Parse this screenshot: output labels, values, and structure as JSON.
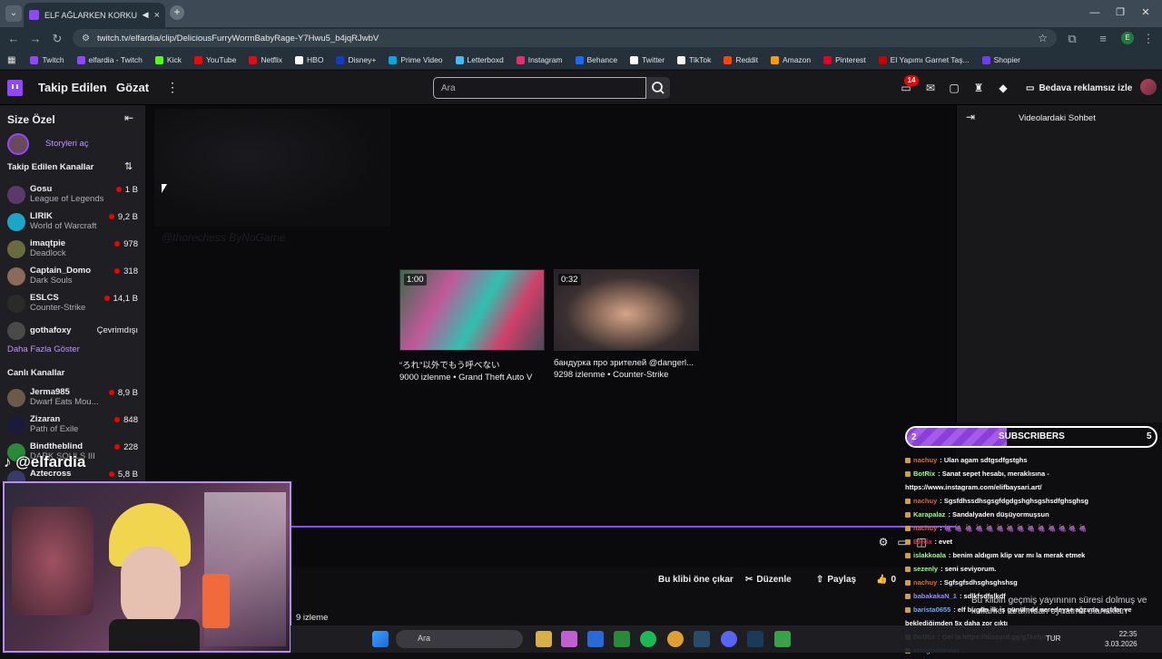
{
  "browser": {
    "tab_title": "ELF AĞLARKEN KORKUYOR",
    "url": "twitch.tv/elfardia/clip/DeliciousFurryWormBabyRage-Y7Hwu5_b4jqRJwbV",
    "profile_initial": "E",
    "bookmarks": [
      {
        "label": "Twitch",
        "color": "#9146ff"
      },
      {
        "label": "elfardia - Twitch",
        "color": "#9146ff"
      },
      {
        "label": "Kick",
        "color": "#53fc18"
      },
      {
        "label": "YouTube",
        "color": "#ff0000"
      },
      {
        "label": "Netflix",
        "color": "#e50914"
      },
      {
        "label": "HBO",
        "color": "#ffffff"
      },
      {
        "label": "Disney+",
        "color": "#113ccf"
      },
      {
        "label": "Prime Video",
        "color": "#00a8e1"
      },
      {
        "label": "Letterboxd",
        "color": "#40bcf4"
      },
      {
        "label": "Instagram",
        "color": "#e1306c"
      },
      {
        "label": "Behance",
        "color": "#1769ff"
      },
      {
        "label": "Twitter",
        "color": "#ffffff"
      },
      {
        "label": "TikTok",
        "color": "#ffffff"
      },
      {
        "label": "Reddit",
        "color": "#ff4500"
      },
      {
        "label": "Amazon",
        "color": "#ff9900"
      },
      {
        "label": "Pinterest",
        "color": "#e60023"
      },
      {
        "label": "El Yapımı Garnet Taş...",
        "color": "#cc0000"
      },
      {
        "label": "Shopier",
        "color": "#6c3ef4"
      }
    ]
  },
  "nav": {
    "following": "Takip Edilen",
    "browse": "Gözat",
    "search_placeholder": "Ara",
    "notif_count": "14",
    "ad_free": "Bedava reklamsız izle"
  },
  "sidebar": {
    "title": "Size Özel",
    "stories": "Storyleri aç",
    "followed_header": "Takip Edilen Kanallar",
    "followed": [
      {
        "name": "Gosu",
        "game": "League of Legends",
        "viewers": "1 B",
        "color": "#5a3a6a"
      },
      {
        "name": "LIRIK",
        "game": "World of Warcraft",
        "viewers": "9,2 B",
        "color": "#1aa7c7"
      },
      {
        "name": "imaqtpie",
        "game": "Deadlock",
        "viewers": "978",
        "color": "#6a6a40"
      },
      {
        "name": "Captain_Domo",
        "game": "Dark Souls",
        "viewers": "318",
        "color": "#8a6a5a"
      },
      {
        "name": "ESLCS",
        "game": "Counter-Strike",
        "viewers": "14,1 B",
        "color": "#2a2a2a"
      },
      {
        "name": "gothafoxy",
        "game": "",
        "viewers": "Çevrimdışı",
        "color": "#4a4a4a"
      }
    ],
    "show_more": "Daha Fazla Göster",
    "live_header": "Canlı Kanallar",
    "live": [
      {
        "name": "Jerma985",
        "game": "Dwarf Eats Mou...",
        "viewers": "8,9 B",
        "color": "#6a5a4a"
      },
      {
        "name": "Zizaran",
        "game": "Path of Exile",
        "viewers": "848",
        "color": "#1a1a3a"
      },
      {
        "name": "Bindtheblind",
        "game": "DARK SOULS III",
        "viewers": "228",
        "color": "#2a8a3a"
      },
      {
        "name": "Aztecross",
        "game": "",
        "viewers": "5,8 B",
        "color": "#3a3a6a"
      }
    ]
  },
  "main": {
    "watermark": "@thorechess ByNoGame",
    "clips": [
      {
        "duration": "1:00",
        "title": "“ろれ”以外でもう呼べない",
        "views": "9000 izlenme",
        "category": "Grand Theft Auto V"
      },
      {
        "duration": "0:32",
        "title": "бандурка про зрителей @dangerl...",
        "views": "9298 izlenme",
        "category": "Counter-Strike"
      }
    ],
    "views": "9 izleme"
  },
  "actions": {
    "feature": "Bu klibi öne çıkar",
    "edit": "Düzenle",
    "share": "Paylaş",
    "likes": "0"
  },
  "chat_panel": {
    "title": "Videolardaki Sohbet"
  },
  "overlay": {
    "handle": "@elfardia",
    "subs": {
      "label": "SUBSCRIBERS",
      "current": 2,
      "goal": 5,
      "progress": 0.4
    },
    "chat": [
      {
        "name": "nachuy",
        "msg": ": Ulan agam sdtgsdfgstghs",
        "color": "#e06a2a"
      },
      {
        "name": "BotRix",
        "msg": ": Sanat sepet hesabı, meraklısına -",
        "color": "#9cff8a"
      },
      {
        "name": "",
        "msg": "https://www.instagram.com/elifbaysari.art/",
        "color": "#ffffff"
      },
      {
        "name": "nachuy",
        "msg": ": Sgsfdhssdhsgsgfdgdgshghsgshsdfghsghsg",
        "color": "#e06a2a"
      },
      {
        "name": "Karapalaz",
        "msg": ": Sandalyaden düşüyormuşsun",
        "color": "#9cff8a"
      },
      {
        "name": "nachuy",
        "msg": ": 🍇 🍇 🍇 🍇 🍇 🍇 🍇 🍇 🍇 🍇 🍇 🍇 🍇 🍇",
        "color": "#e06a2a"
      },
      {
        "name": "Bleda",
        "msg": ": evet",
        "color": "#e02a4a"
      },
      {
        "name": "islakkoala",
        "msg": ": benim aldıgım klip var mı la merak etmek",
        "color": "#9cff8a"
      },
      {
        "name": "sezenly",
        "msg": ": seni seviyorum.",
        "color": "#9cff8a"
      },
      {
        "name": "nachuy",
        "msg": ": Sgfsgfsdhsghsghshsg",
        "color": "#e06a2a"
      },
      {
        "name": "babakakaN_1",
        "msg": ": sdlkfsdfslkdf",
        "color": "#9a8aff"
      },
      {
        "name": "barista0655",
        "msg": ": elf bugün ilk iş günümde neredeyse ağzıma sıçtılar ve",
        "color": "#6aaaff"
      },
      {
        "name": "",
        "msg": "beklediğimden 5x daha zor çıktı",
        "color": "#ffffff"
      },
      {
        "name": "BotRix",
        "msg": ": Gel la https://discord.gg/g7ketysDR4",
        "color": "#9cff8a"
      },
      {
        "name": "ertugruldeviez",
        "msg": ":",
        "color": "#6aaaff"
      }
    ],
    "bottom_notice": "Bu klibin geçmiş yayınının süresi dolmuş ve kullanıcı tarafından oynatma olanakları"
  },
  "taskbar": {
    "search": "Ara",
    "lang": "TUR",
    "time": "22:35",
    "date": "3.03.2026"
  }
}
